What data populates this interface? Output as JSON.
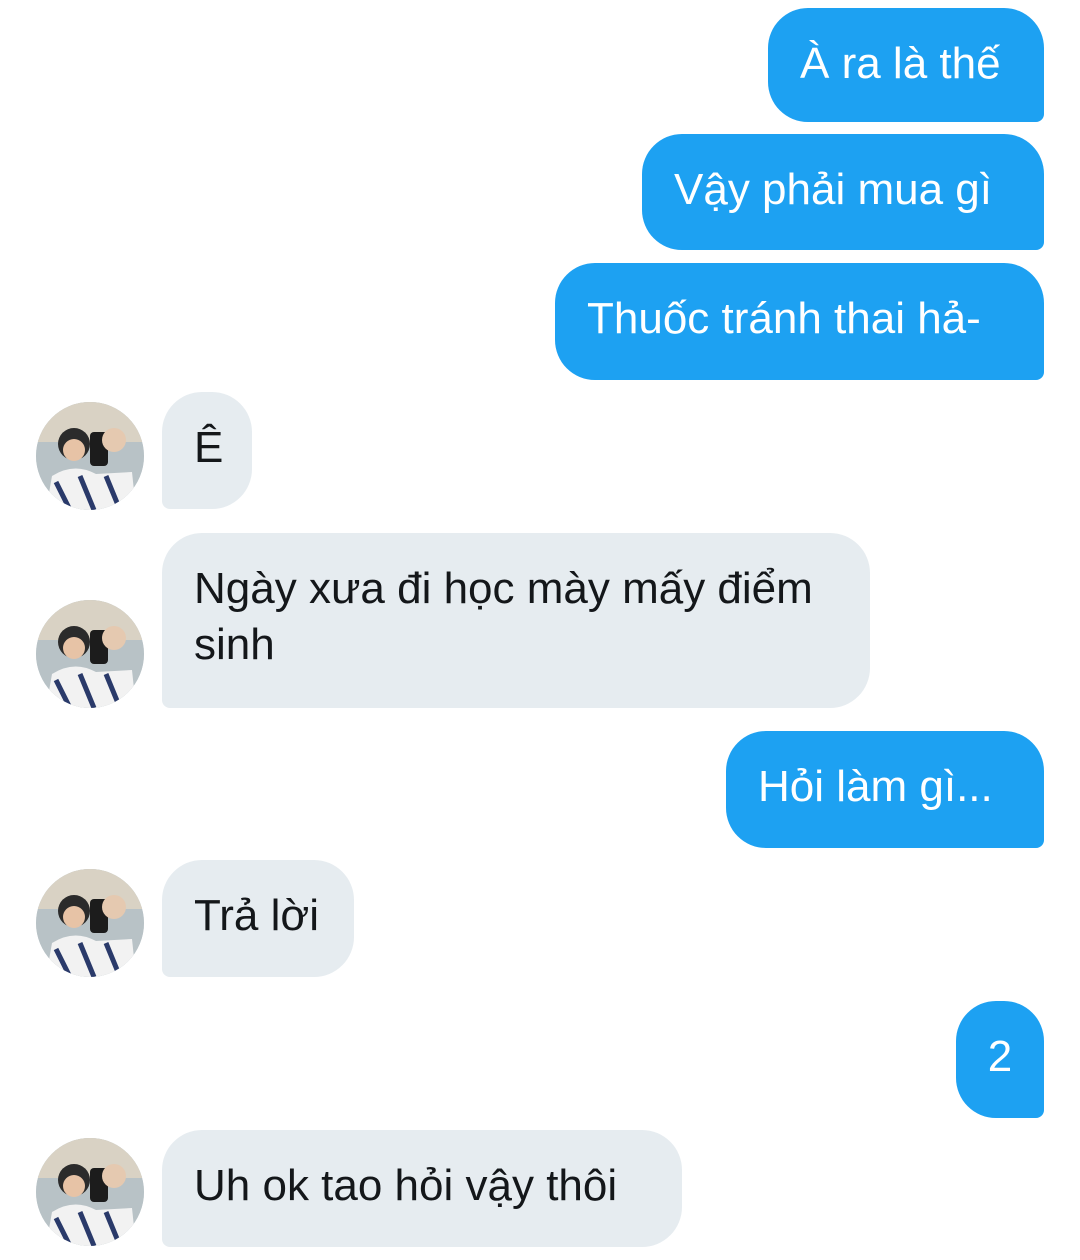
{
  "conversation": {
    "messages": [
      {
        "side": "sent",
        "text": "À ra là thế"
      },
      {
        "side": "sent",
        "text": "Vậy phải mua gì"
      },
      {
        "side": "sent",
        "text": "Thuốc tránh thai hả-"
      },
      {
        "side": "received",
        "text": "Ê"
      },
      {
        "side": "received",
        "text": "Ngày xưa đi học mày mấy điểm sinh"
      },
      {
        "side": "sent",
        "text": "Hỏi làm gì..."
      },
      {
        "side": "received",
        "text": "Trả lời"
      },
      {
        "side": "sent",
        "text": "2"
      },
      {
        "side": "received",
        "text": "Uh ok tao hỏi vậy thôi"
      }
    ]
  },
  "colors": {
    "sent_bubble": "#1da1f2",
    "received_bubble": "#e6ecf0",
    "received_text": "#14171a",
    "background": "#ffffff"
  },
  "icons": {
    "avatar": "user-avatar-photo"
  }
}
